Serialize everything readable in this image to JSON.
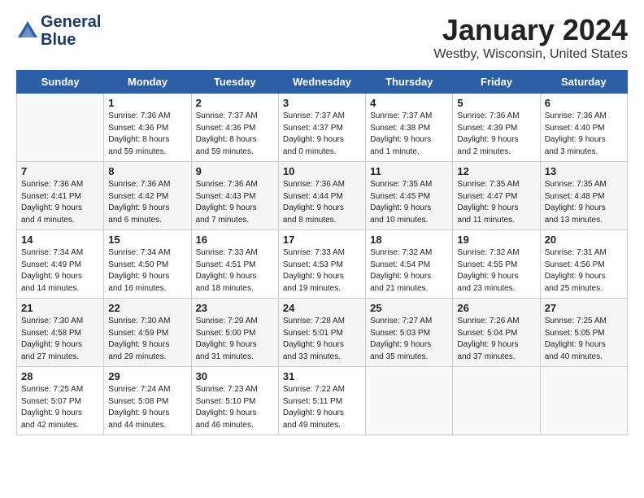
{
  "logo": {
    "line1": "General",
    "line2": "Blue"
  },
  "title": "January 2024",
  "location": "Westby, Wisconsin, United States",
  "weekdays": [
    "Sunday",
    "Monday",
    "Tuesday",
    "Wednesday",
    "Thursday",
    "Friday",
    "Saturday"
  ],
  "weeks": [
    [
      {
        "num": "",
        "info": ""
      },
      {
        "num": "1",
        "info": "Sunrise: 7:36 AM\nSunset: 4:36 PM\nDaylight: 8 hours\nand 59 minutes."
      },
      {
        "num": "2",
        "info": "Sunrise: 7:37 AM\nSunset: 4:36 PM\nDaylight: 8 hours\nand 59 minutes."
      },
      {
        "num": "3",
        "info": "Sunrise: 7:37 AM\nSunset: 4:37 PM\nDaylight: 9 hours\nand 0 minutes."
      },
      {
        "num": "4",
        "info": "Sunrise: 7:37 AM\nSunset: 4:38 PM\nDaylight: 9 hours\nand 1 minute."
      },
      {
        "num": "5",
        "info": "Sunrise: 7:36 AM\nSunset: 4:39 PM\nDaylight: 9 hours\nand 2 minutes."
      },
      {
        "num": "6",
        "info": "Sunrise: 7:36 AM\nSunset: 4:40 PM\nDaylight: 9 hours\nand 3 minutes."
      }
    ],
    [
      {
        "num": "7",
        "info": "Sunrise: 7:36 AM\nSunset: 4:41 PM\nDaylight: 9 hours\nand 4 minutes."
      },
      {
        "num": "8",
        "info": "Sunrise: 7:36 AM\nSunset: 4:42 PM\nDaylight: 9 hours\nand 6 minutes."
      },
      {
        "num": "9",
        "info": "Sunrise: 7:36 AM\nSunset: 4:43 PM\nDaylight: 9 hours\nand 7 minutes."
      },
      {
        "num": "10",
        "info": "Sunrise: 7:36 AM\nSunset: 4:44 PM\nDaylight: 9 hours\nand 8 minutes."
      },
      {
        "num": "11",
        "info": "Sunrise: 7:35 AM\nSunset: 4:45 PM\nDaylight: 9 hours\nand 10 minutes."
      },
      {
        "num": "12",
        "info": "Sunrise: 7:35 AM\nSunset: 4:47 PM\nDaylight: 9 hours\nand 11 minutes."
      },
      {
        "num": "13",
        "info": "Sunrise: 7:35 AM\nSunset: 4:48 PM\nDaylight: 9 hours\nand 13 minutes."
      }
    ],
    [
      {
        "num": "14",
        "info": "Sunrise: 7:34 AM\nSunset: 4:49 PM\nDaylight: 9 hours\nand 14 minutes."
      },
      {
        "num": "15",
        "info": "Sunrise: 7:34 AM\nSunset: 4:50 PM\nDaylight: 9 hours\nand 16 minutes."
      },
      {
        "num": "16",
        "info": "Sunrise: 7:33 AM\nSunset: 4:51 PM\nDaylight: 9 hours\nand 18 minutes."
      },
      {
        "num": "17",
        "info": "Sunrise: 7:33 AM\nSunset: 4:53 PM\nDaylight: 9 hours\nand 19 minutes."
      },
      {
        "num": "18",
        "info": "Sunrise: 7:32 AM\nSunset: 4:54 PM\nDaylight: 9 hours\nand 21 minutes."
      },
      {
        "num": "19",
        "info": "Sunrise: 7:32 AM\nSunset: 4:55 PM\nDaylight: 9 hours\nand 23 minutes."
      },
      {
        "num": "20",
        "info": "Sunrise: 7:31 AM\nSunset: 4:56 PM\nDaylight: 9 hours\nand 25 minutes."
      }
    ],
    [
      {
        "num": "21",
        "info": "Sunrise: 7:30 AM\nSunset: 4:58 PM\nDaylight: 9 hours\nand 27 minutes."
      },
      {
        "num": "22",
        "info": "Sunrise: 7:30 AM\nSunset: 4:59 PM\nDaylight: 9 hours\nand 29 minutes."
      },
      {
        "num": "23",
        "info": "Sunrise: 7:29 AM\nSunset: 5:00 PM\nDaylight: 9 hours\nand 31 minutes."
      },
      {
        "num": "24",
        "info": "Sunrise: 7:28 AM\nSunset: 5:01 PM\nDaylight: 9 hours\nand 33 minutes."
      },
      {
        "num": "25",
        "info": "Sunrise: 7:27 AM\nSunset: 5:03 PM\nDaylight: 9 hours\nand 35 minutes."
      },
      {
        "num": "26",
        "info": "Sunrise: 7:26 AM\nSunset: 5:04 PM\nDaylight: 9 hours\nand 37 minutes."
      },
      {
        "num": "27",
        "info": "Sunrise: 7:25 AM\nSunset: 5:05 PM\nDaylight: 9 hours\nand 40 minutes."
      }
    ],
    [
      {
        "num": "28",
        "info": "Sunrise: 7:25 AM\nSunset: 5:07 PM\nDaylight: 9 hours\nand 42 minutes."
      },
      {
        "num": "29",
        "info": "Sunrise: 7:24 AM\nSunset: 5:08 PM\nDaylight: 9 hours\nand 44 minutes."
      },
      {
        "num": "30",
        "info": "Sunrise: 7:23 AM\nSunset: 5:10 PM\nDaylight: 9 hours\nand 46 minutes."
      },
      {
        "num": "31",
        "info": "Sunrise: 7:22 AM\nSunset: 5:11 PM\nDaylight: 9 hours\nand 49 minutes."
      },
      {
        "num": "",
        "info": ""
      },
      {
        "num": "",
        "info": ""
      },
      {
        "num": "",
        "info": ""
      }
    ]
  ]
}
